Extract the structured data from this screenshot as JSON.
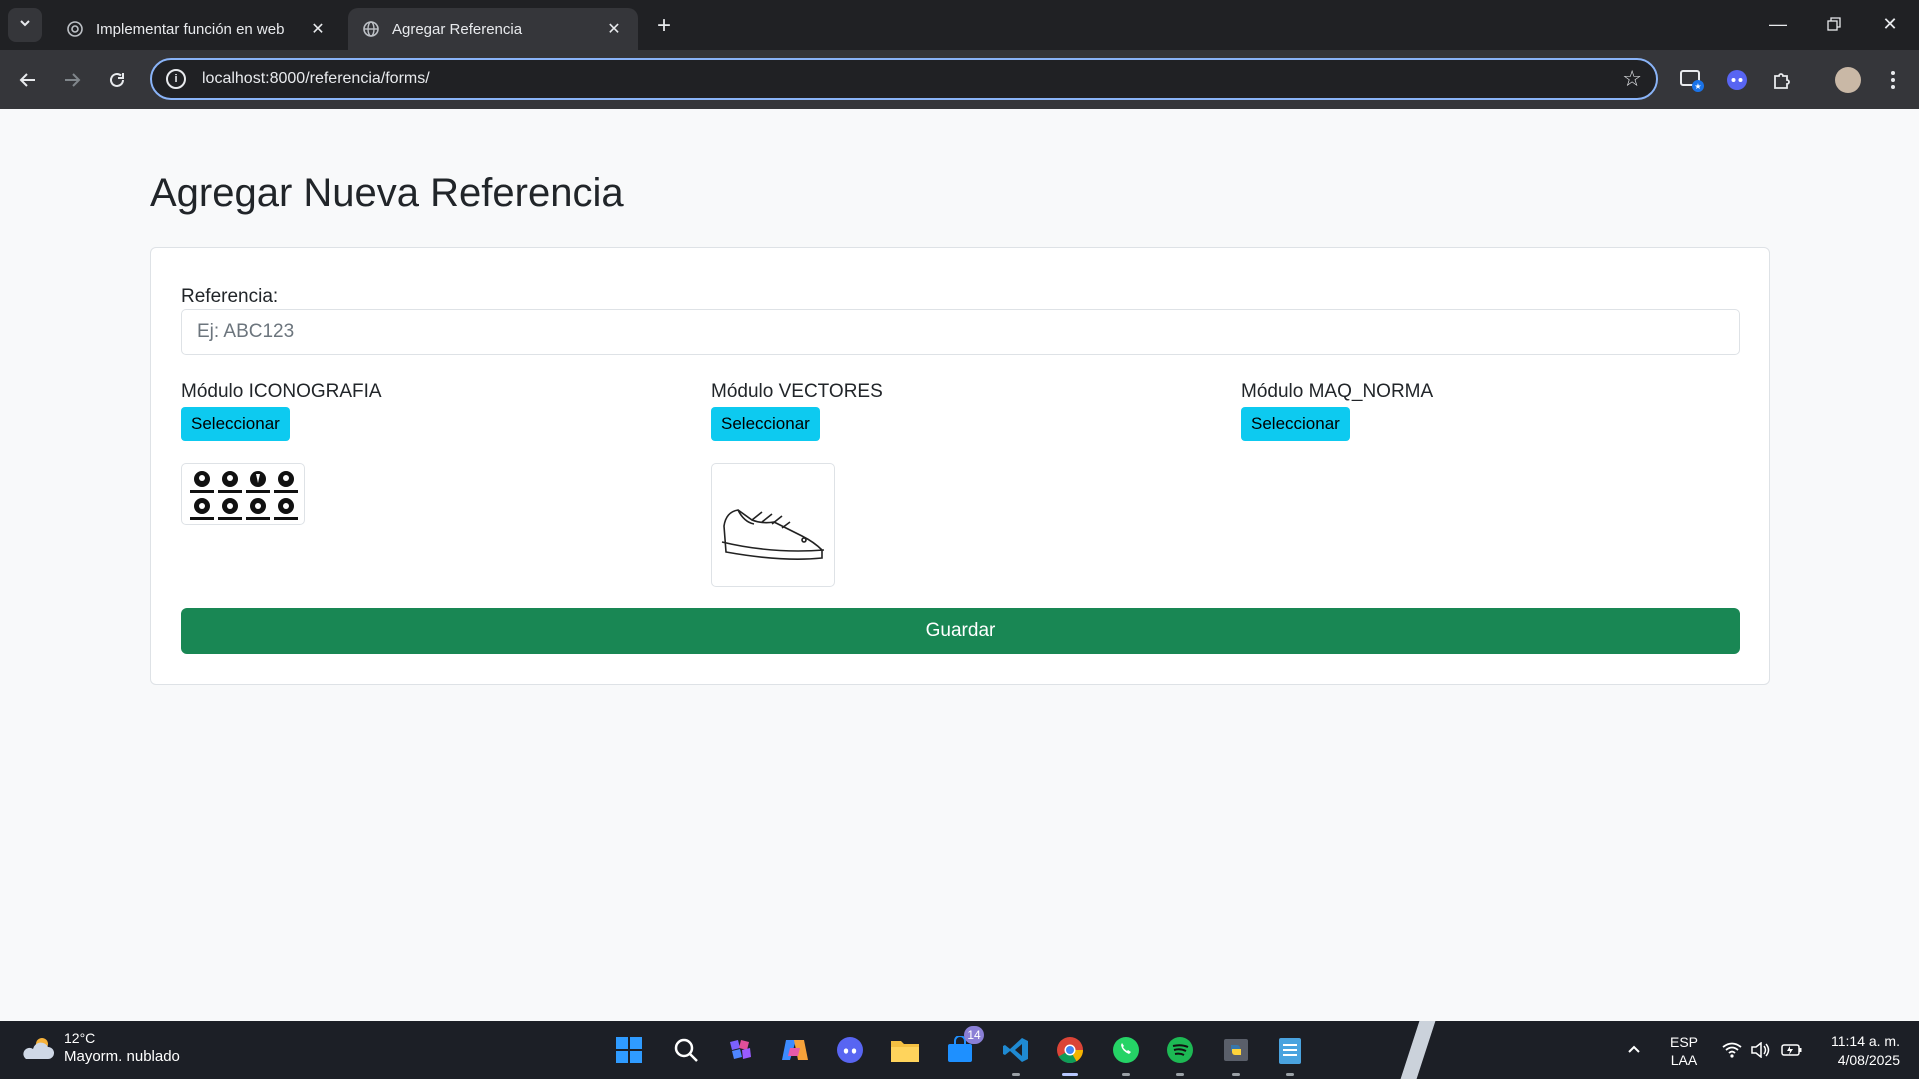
{
  "browser": {
    "tabs": [
      {
        "label": "Implementar función en web",
        "active": false,
        "icon": "openai-icon"
      },
      {
        "label": "Agregar Referencia",
        "active": true,
        "icon": "globe-icon"
      }
    ],
    "url": "localhost:8000/referencia/forms/"
  },
  "page": {
    "title": "Agregar Nueva Referencia",
    "reference_label": "Referencia:",
    "reference_placeholder": "Ej: ABC123",
    "reference_value": "",
    "modules": [
      {
        "title": "Módulo ICONOGRAFIA",
        "button": "Seleccionar",
        "has_preview": true,
        "preview": "safety-pictograms"
      },
      {
        "title": "Módulo VECTORES",
        "button": "Seleccionar",
        "has_preview": true,
        "preview": "shoe-vector"
      },
      {
        "title": "Módulo MAQ_NORMA",
        "button": "Seleccionar",
        "has_preview": false
      }
    ],
    "save_button": "Guardar"
  },
  "taskbar": {
    "weather_temp": "12°C",
    "weather_desc": "Mayorm. nublado",
    "apps": [
      "windows-start",
      "search",
      "winget-store",
      "copilot",
      "discord",
      "file-explorer",
      "microsoft-store",
      "vscode",
      "chrome",
      "whatsapp",
      "spotify",
      "python",
      "notepad"
    ],
    "store_badge": "14",
    "language_top": "ESP",
    "language_bottom": "LAA",
    "time": "11:14 a. m.",
    "date": "4/08/2025"
  },
  "colors": {
    "select_button": "#0dcaf0",
    "save_button": "#198754",
    "omnibox_focus": "#8ab4f8"
  }
}
